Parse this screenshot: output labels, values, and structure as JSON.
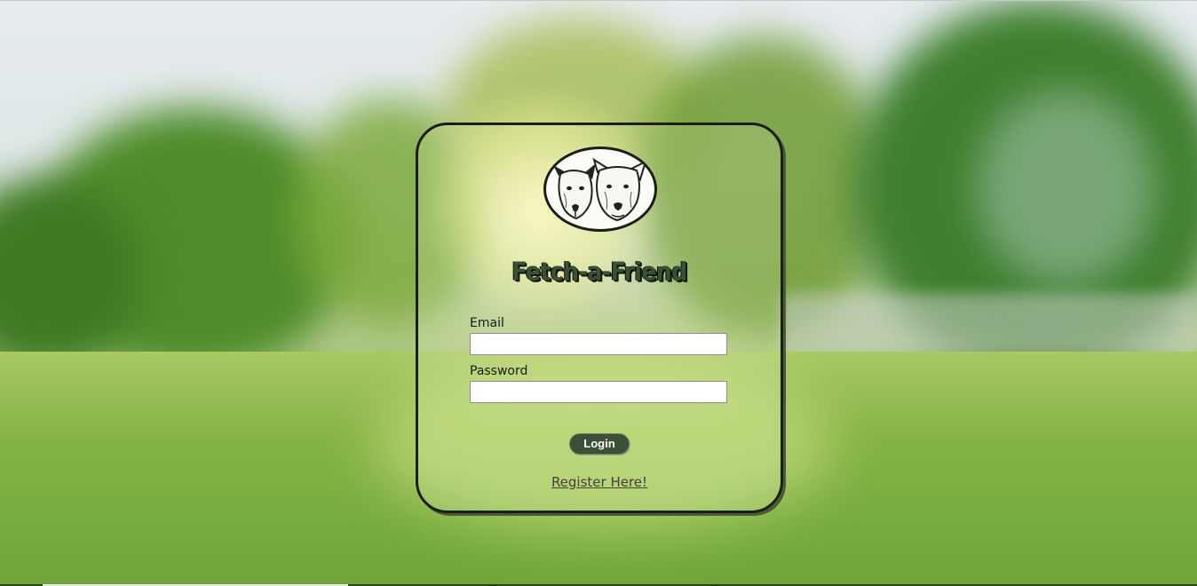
{
  "app": {
    "name": "Fetch-a-Friend"
  },
  "logo": {
    "icon": "two-dogs-logo-icon"
  },
  "form": {
    "email_label": "Email",
    "email_value": "",
    "password_label": "Password",
    "password_value": "",
    "login_label": "Login",
    "register_label": "Register Here!"
  },
  "colors": {
    "card_border": "#1b1e15",
    "brand_text": "#3b5034",
    "button_bg": "#3d4f36",
    "button_text": "#ffffff",
    "link_text": "#45403e"
  }
}
